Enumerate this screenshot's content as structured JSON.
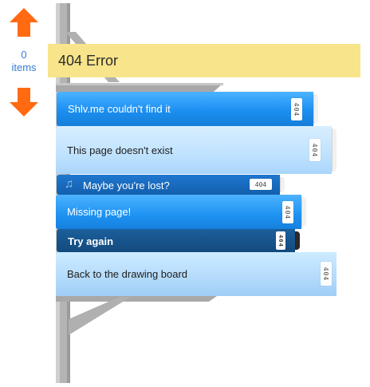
{
  "vote": {
    "count": "0",
    "count_label": "items",
    "up_icon": "arrow-up-icon",
    "down_icon": "arrow-down-icon",
    "arrow_color": "#ff6a13"
  },
  "title": "404 Error",
  "colors": {
    "title_bg": "#f8e48a",
    "shelf": "#a9a9a9",
    "book_blue": "#1b8ff2",
    "book_light": "#bfe2ff",
    "book_navy": "#135fae",
    "book_dark": "#134a7d"
  },
  "books": [
    {
      "label": "Shlv.me couldn't find it",
      "tag": "404"
    },
    {
      "label": "This page doesn't exist",
      "tag": "404"
    },
    {
      "label": "Maybe you're lost?",
      "tag": "404",
      "icon": "music-note-icon"
    },
    {
      "label": "Missing page!",
      "tag": "404"
    },
    {
      "label": "Try again",
      "tag": "404"
    },
    {
      "label": "Back to the drawing board",
      "tag": "404"
    }
  ]
}
